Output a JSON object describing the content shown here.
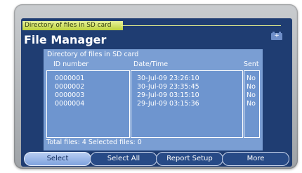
{
  "window": {
    "title_tab": "Directory of files in SD card",
    "app_title": "File Manager",
    "battery_symbol": "+"
  },
  "panel": {
    "title": "Directory of files in SD card",
    "columns": [
      "ID number",
      "Date/Time",
      "Sent"
    ],
    "rows": [
      {
        "id": "0000001",
        "datetime": "30-Jul-09 23:26:10",
        "sent": "No"
      },
      {
        "id": "0000002",
        "datetime": "30-Jul-09 23:35:45",
        "sent": "No"
      },
      {
        "id": "0000003",
        "datetime": "29-Jul-09 03:15:10",
        "sent": "No"
      },
      {
        "id": "0000004",
        "datetime": "29-Jul-09 03:15:36",
        "sent": "No"
      }
    ]
  },
  "footer": {
    "summary": "Total files:  4  Selected files:  0"
  },
  "softkeys": [
    "Select",
    "Select All",
    "Report Setup",
    "More"
  ],
  "colors": {
    "screen_bg": "#1f3d72",
    "panel_bg": "#7a9ed3",
    "title_tab_bg": "#c9dc5a",
    "active_softkey": "#a8c1ea"
  }
}
